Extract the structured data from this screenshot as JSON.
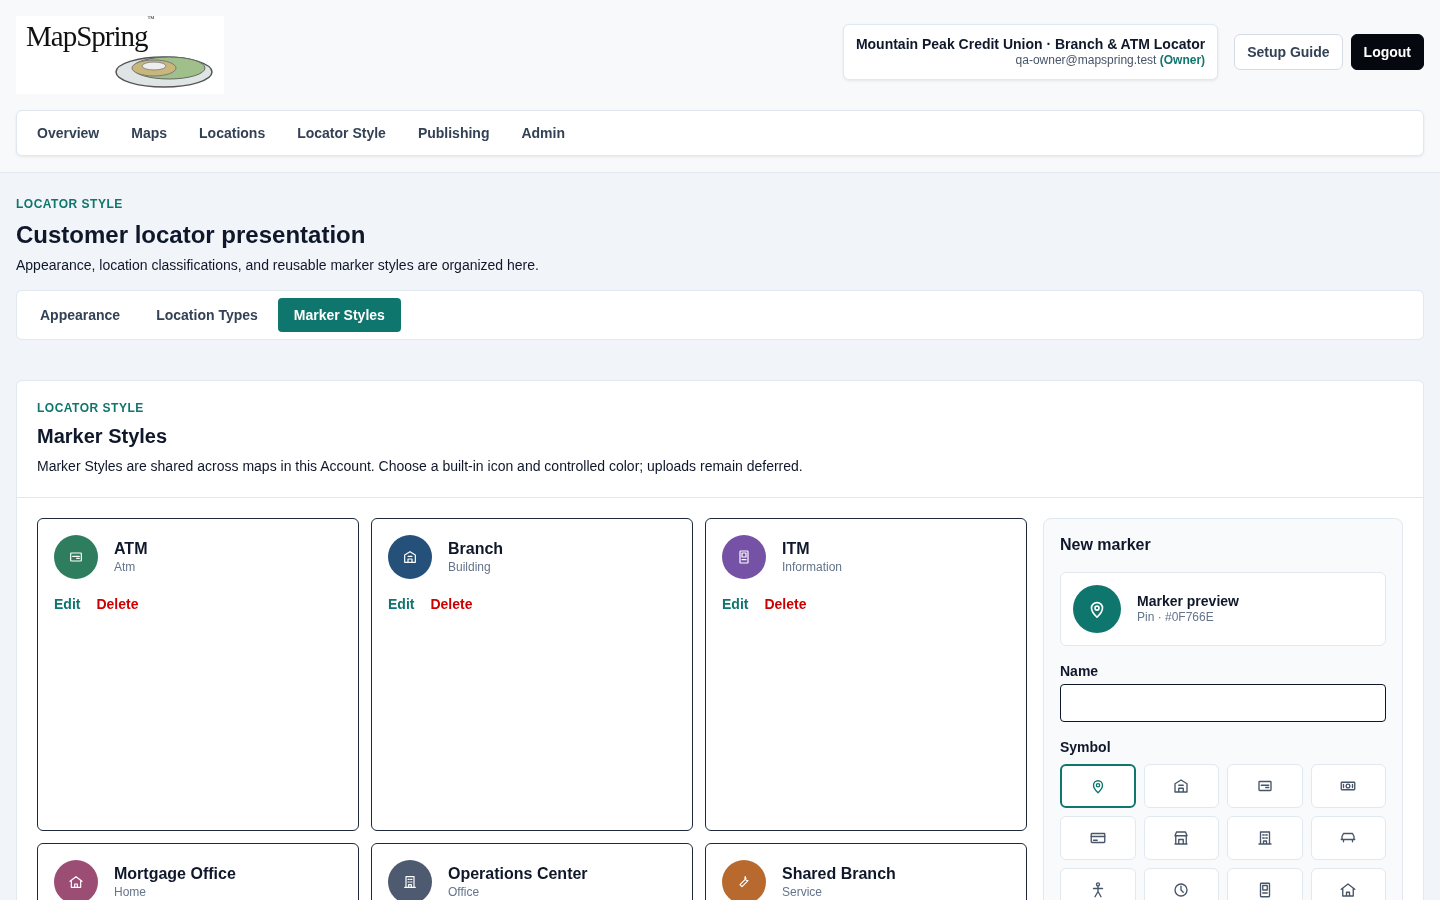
{
  "logo": {
    "text": "MapSpring",
    "mark": "™"
  },
  "account": {
    "title": "Mountain Peak Credit Union · Branch & ATM Locator",
    "email": "qa-owner@mapspring.test",
    "role": "(Owner)"
  },
  "header_buttons": [
    {
      "label": "Setup Guide",
      "kind": "outline"
    },
    {
      "label": "Logout",
      "kind": "dark"
    }
  ],
  "nav": [
    {
      "label": "Overview",
      "selected": false
    },
    {
      "label": "Maps",
      "selected": false
    },
    {
      "label": "Locations",
      "selected": false
    },
    {
      "label": "Locator Style",
      "selected": false
    },
    {
      "label": "Publishing",
      "selected": false
    },
    {
      "label": "Admin",
      "selected": false
    }
  ],
  "page": {
    "eyebrow": "LOCATOR STYLE",
    "title": "Customer locator presentation",
    "subtitle": "Appearance, location classifications, and reusable marker styles are organized here."
  },
  "tabs": [
    {
      "label": "Appearance",
      "selected": false
    },
    {
      "label": "Location Types",
      "selected": false
    },
    {
      "label": "Marker Styles",
      "selected": true
    }
  ],
  "section": {
    "eyebrow": "LOCATOR STYLE",
    "title": "Marker Styles",
    "description": "Marker Styles are shared across maps in this Account. Choose a built-in icon and controlled color; uploads remain deferred."
  },
  "markers": [
    {
      "name": "ATM",
      "type": "Atm",
      "kind": "atm",
      "color": "#2f7d5f",
      "actions": [
        "Edit",
        "Delete"
      ]
    },
    {
      "name": "Branch",
      "type": "Building",
      "kind": "building",
      "color": "#24507a",
      "actions": [
        "Edit",
        "Delete"
      ]
    },
    {
      "name": "ITM",
      "type": "Information",
      "kind": "kiosk",
      "color": "#7652a6",
      "actions": [
        "Edit",
        "Delete"
      ]
    },
    {
      "name": "Mortgage Office",
      "type": "Home",
      "kind": "home",
      "color": "#9c4d73"
    },
    {
      "name": "Operations Center",
      "type": "Office",
      "kind": "office",
      "color": "#4d5a70"
    },
    {
      "name": "Shared Branch",
      "type": "Service",
      "kind": "wrench",
      "color": "#b8692e"
    }
  ],
  "new_marker": {
    "title": "New marker",
    "preview": {
      "title": "Marker preview",
      "detail": "Pin · #0F766E",
      "kind": "pin",
      "color": "#0f766e"
    },
    "name_label": "Name",
    "symbol_label": "Symbol",
    "symbols": [
      {
        "kind": "pin",
        "selected": true
      },
      {
        "kind": "building",
        "selected": false
      },
      {
        "kind": "atm",
        "selected": false
      },
      {
        "kind": "money",
        "selected": false
      },
      {
        "kind": "card",
        "selected": false
      },
      {
        "kind": "store",
        "selected": false
      },
      {
        "kind": "office",
        "selected": false
      },
      {
        "kind": "car",
        "selected": false
      },
      {
        "kind": "person",
        "selected": false
      },
      {
        "kind": "clock",
        "selected": false
      },
      {
        "kind": "kiosk",
        "selected": false
      },
      {
        "kind": "home",
        "selected": false
      }
    ]
  }
}
